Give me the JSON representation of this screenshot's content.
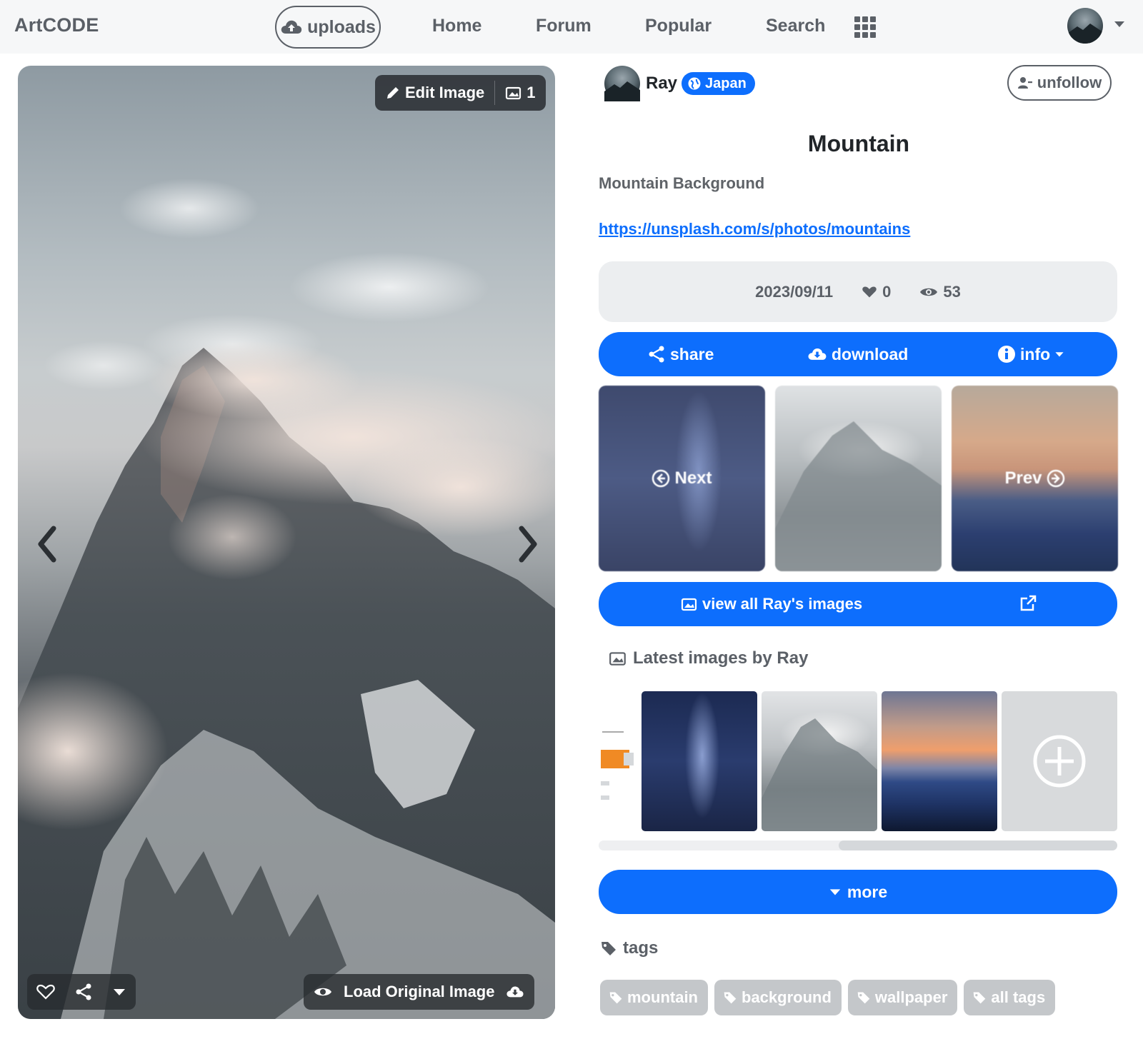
{
  "navbar": {
    "brand": "ArtCODE",
    "uploads_label": "uploads",
    "links": [
      "Home",
      "Forum",
      "Popular",
      "Search"
    ],
    "icons": {
      "uploads": "cloud-upload-icon",
      "apps": "grid-icon"
    }
  },
  "image_viewer": {
    "edit_label": "Edit Image",
    "image_count": "1",
    "load_original_label": "Load Original Image"
  },
  "author": {
    "name": "Ray",
    "country": "Japan",
    "unfollow_label": "unfollow"
  },
  "post": {
    "title": "Mountain",
    "description": "Mountain Background",
    "link": "https://unsplash.com/s/photos/mountains",
    "date": "2023/09/11",
    "likes": "0",
    "views": "53"
  },
  "actions": {
    "share": "share",
    "download": "download",
    "info": "info"
  },
  "thumb_nav": {
    "next": "Next",
    "prev": "Prev"
  },
  "view_all_label": "view all Ray's images",
  "latest": {
    "heading": "Latest images by Ray"
  },
  "more_label": "more",
  "tags": {
    "heading": "tags",
    "items": [
      "mountain",
      "background",
      "wallpaper",
      "all tags"
    ]
  },
  "colors": {
    "primary": "#0d6efd",
    "nav_bg": "#f6f7f8",
    "tag_bg": "#c4c7ca",
    "meta_bg": "#eceef0"
  }
}
